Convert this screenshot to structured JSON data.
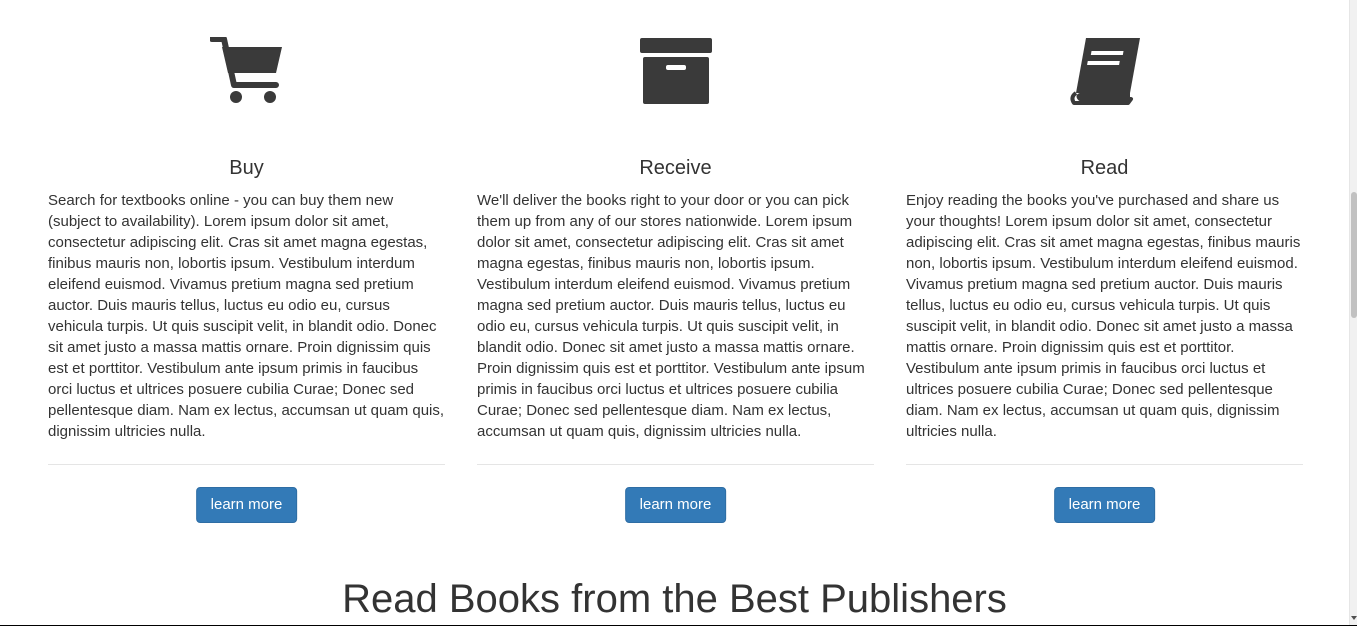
{
  "features": [
    {
      "icon": "shopping-cart-icon",
      "title": "Buy",
      "text": "Search for textbooks online - you can buy them new (subject to availability). Lorem ipsum dolor sit amet, consectetur adipiscing elit. Cras sit amet magna egestas, finibus mauris non, lobortis ipsum. Vestibulum interdum eleifend euismod. Vivamus pretium magna sed pretium auctor. Duis mauris tellus, luctus eu odio eu, cursus vehicula turpis. Ut quis suscipit velit, in blandit odio. Donec sit amet justo a massa mattis ornare. Proin dignissim quis est et porttitor. Vestibulum ante ipsum primis in faucibus orci luctus et ultrices posuere cubilia Curae; Donec sed pellentesque diam. Nam ex lectus, accumsan ut quam quis, dignissim ultricies nulla.",
      "button_label": "learn more"
    },
    {
      "icon": "archive-box-icon",
      "title": "Receive",
      "text": "We'll deliver the books right to your door or you can pick them up from any of our stores nationwide. Lorem ipsum dolor sit amet, consectetur adipiscing elit. Cras sit amet magna egestas, finibus mauris non, lobortis ipsum. Vestibulum interdum eleifend euismod. Vivamus pretium magna sed pretium auctor. Duis mauris tellus, luctus eu odio eu, cursus vehicula turpis. Ut quis suscipit velit, in blandit odio. Donec sit amet justo a massa mattis ornare. Proin dignissim quis est et porttitor. Vestibulum ante ipsum primis in faucibus orci luctus et ultrices posuere cubilia Curae; Donec sed pellentesque diam. Nam ex lectus, accumsan ut quam quis, dignissim ultricies nulla.",
      "button_label": "learn more"
    },
    {
      "icon": "book-icon",
      "title": "Read",
      "text": "Enjoy reading the books you've purchased and share us your thoughts! Lorem ipsum dolor sit amet, consectetur adipiscing elit. Cras sit amet magna egestas, finibus mauris non, lobortis ipsum. Vestibulum interdum eleifend euismod. Vivamus pretium magna sed pretium auctor. Duis mauris tellus, luctus eu odio eu, cursus vehicula turpis. Ut quis suscipit velit, in blandit odio. Donec sit amet justo a massa mattis ornare. Proin dignissim quis est et porttitor. Vestibulum ante ipsum primis in faucibus orci luctus et ultrices posuere cubilia Curae; Donec sed pellentesque diam. Nam ex lectus, accumsan ut quam quis, dignissim ultricies nulla.",
      "button_label": "learn more"
    }
  ],
  "publishers_section": {
    "heading": "Read Books from the Best Publishers"
  },
  "colors": {
    "text": "#333333",
    "icon": "#3a3a3a",
    "button_bg": "#337ab7",
    "button_border": "#2e6da4",
    "divider": "#e5e5e5"
  }
}
